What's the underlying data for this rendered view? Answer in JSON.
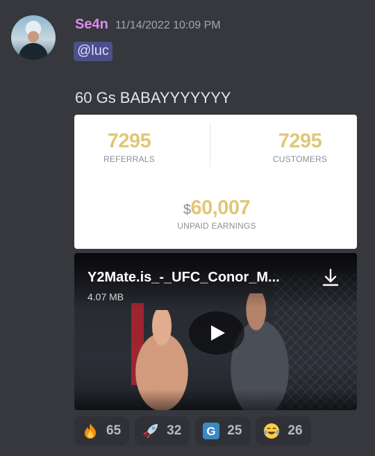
{
  "message": {
    "author": "Se4n",
    "timestamp": "11/14/2022 10:09 PM",
    "mention": "@luc",
    "text": "60 Gs BABAYYYYYYY"
  },
  "stats_card": {
    "referrals_value": "7295",
    "referrals_label": "REFERRALS",
    "customers_value": "7295",
    "customers_label": "CUSTOMERS",
    "earnings_currency": "$",
    "earnings_value": "60,007",
    "earnings_label": "UNPAID EARNINGS"
  },
  "video": {
    "title": "Y2Mate.is_-_UFC_Conor_M...",
    "size": "4.07 MB",
    "icons": [
      "download-icon",
      "play-icon"
    ]
  },
  "reactions": [
    {
      "emoji": "fire",
      "count": "65"
    },
    {
      "emoji": "rocket",
      "count": "32"
    },
    {
      "emoji": "g-badge",
      "count": "25"
    },
    {
      "emoji": "joy",
      "count": "26"
    }
  ],
  "colors": {
    "background": "#36383d",
    "username": "#d98df2",
    "mention_bg": "#4b4f8a",
    "stat_gold": "#e0c777",
    "reaction_bg": "#2f3136"
  }
}
